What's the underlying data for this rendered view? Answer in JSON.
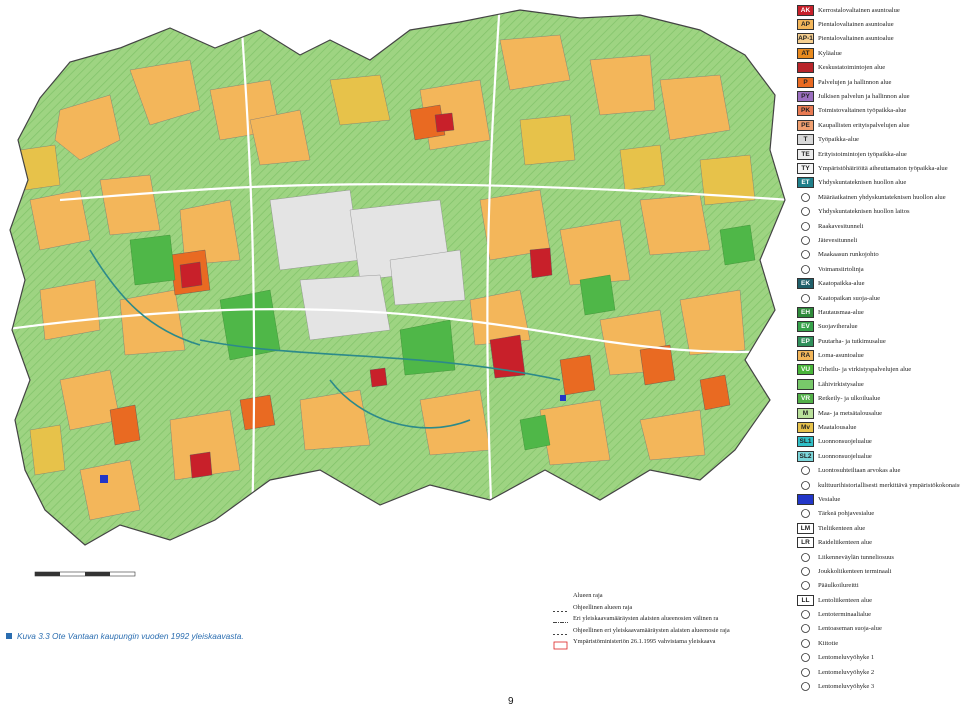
{
  "caption": "Kuva 3.3 Ote Vantaan kaupungin vuoden 1992 yleiskaavasta.",
  "page_number": "9",
  "legend": [
    {
      "code": "AK",
      "label": "Kerrostalovaltainen asuntoalue",
      "color": "#c8202a"
    },
    {
      "code": "AP",
      "label": "Pientalovaltainen asuntoalue",
      "color": "#f3b65a"
    },
    {
      "code": "AP-1",
      "label": "Pientalovaltainen asuntoalue",
      "color": "#f6cf8f"
    },
    {
      "code": "AT",
      "label": "Kyläalue",
      "color": "#e98a1e"
    },
    {
      "code": "",
      "label": "Keskustatoimintojen alue",
      "color": "#b8242a"
    },
    {
      "code": "P",
      "label": "Palvelujen ja hallinnon alue",
      "color": "#e96a22"
    },
    {
      "code": "PY",
      "label": "Julkisen palvelun ja hallinnon alue",
      "color": "#9b6fc0"
    },
    {
      "code": "PK",
      "label": "Toimistovaltainen työpaikka-alue",
      "color": "#e87a52"
    },
    {
      "code": "PE",
      "label": "Kaupallisten erityispalvelujen alue",
      "color": "#f0a070"
    },
    {
      "code": "T",
      "label": "Työpaikka-alue",
      "color": "#d8d8d8"
    },
    {
      "code": "TE",
      "label": "Erityistoimintojen työpaikka-alue",
      "color": "#ececec"
    },
    {
      "code": "TY",
      "label": "Ympäristöhäiriöitä aiheuttamaton työpaikka-alue",
      "color": "#f4f4f4"
    },
    {
      "code": "ET",
      "label": "Yhdyskuntateknisen huollon alue",
      "color": "#1f7f8a"
    },
    {
      "code": "",
      "label": "Määräaikainen yhdyskuntateknisen huollon alue",
      "color": "#ffffff",
      "symbol": "circle-arrow"
    },
    {
      "code": "",
      "label": "Yhdyskuntateknisen huollon laitos",
      "color": "#ffffff",
      "symbol": "circle-dash"
    },
    {
      "code": "",
      "label": "Raakavesitunneli",
      "color": "#ffffff",
      "symbol": "dash-circle"
    },
    {
      "code": "",
      "label": "Jätevesitunneli",
      "color": "#ffffff",
      "symbol": "dash-circle"
    },
    {
      "code": "",
      "label": "Maakaasun runkojohto",
      "color": "#ffffff",
      "symbol": "dash-circle"
    },
    {
      "code": "",
      "label": "Voimansiirtolinja",
      "color": "#ffffff",
      "symbol": "lightning"
    },
    {
      "code": "EK",
      "label": "Kaatopaikka-alue",
      "color": "#1f5f6a"
    },
    {
      "code": "",
      "label": "Kaatopaikan suoja-alue",
      "color": "#ffffff",
      "symbol": "circle-arrow"
    },
    {
      "code": "EH",
      "label": "Hautausmaa-alue",
      "color": "#2e8a3a"
    },
    {
      "code": "EV",
      "label": "Suojaviheralue",
      "color": "#36a24a"
    },
    {
      "code": "EP",
      "label": "Puutarha- ja tutkimusalue",
      "color": "#2f8f5a"
    },
    {
      "code": "RA",
      "label": "Loma-asuntoalue",
      "color": "#f3b65a"
    },
    {
      "code": "VU",
      "label": "Urheilu- ja virkistyspalvelujen alue",
      "color": "#49b53a"
    },
    {
      "code": "",
      "label": "Lähivirkistysalue",
      "color": "#78c86a"
    },
    {
      "code": "VR",
      "label": "Retkeily- ja ulkoilualue",
      "color": "#52b048"
    },
    {
      "code": "M",
      "label": "Maa- ja metsätalousalue",
      "color": "#b9e09a"
    },
    {
      "code": "Mv",
      "label": "Maatalousalue",
      "color": "#e7c24a"
    },
    {
      "code": "SL1",
      "label": "Luonnonsuojelualue",
      "color": "#2fc0c8"
    },
    {
      "code": "SL2",
      "label": "Luonnonsuojelualue",
      "color": "#7cd6da"
    },
    {
      "code": "",
      "label": "Luontosuhteiltaan arvokas alue",
      "color": "#ffffff",
      "symbol": "hatch-green"
    },
    {
      "code": "",
      "label": "kulttuurihistoriallisesti merkittävä ympäristökokonaisuus",
      "color": "#ffffff",
      "symbol": "hatch-grey"
    },
    {
      "code": "",
      "label": "Vesialue",
      "color": "#2236c8"
    },
    {
      "code": "",
      "label": "Tärkeä pohjavesialue",
      "color": "#ffffff",
      "symbol": "dots"
    },
    {
      "code": "LM",
      "label": "Tieliikenteen alue",
      "color": "#ffffff"
    },
    {
      "code": "LR",
      "label": "Raideliikenteen alue",
      "color": "#ffffff"
    },
    {
      "code": "",
      "label": "Liikenneväylän tunneliosuus",
      "color": "#ffffff",
      "symbol": "tunnel"
    },
    {
      "code": "",
      "label": "Joukkoliikenteen terminaali",
      "color": "#ffffff",
      "symbol": "terminal"
    },
    {
      "code": "",
      "label": "Pääulkoilureitti",
      "color": "#ffffff",
      "symbol": "dotted-line"
    },
    {
      "code": "LL",
      "label": "Lentoliikenteen alue",
      "color": "#ffffff"
    },
    {
      "code": "",
      "label": "Lentoterminaalialue",
      "color": "#ffffff",
      "symbol": "plane"
    },
    {
      "code": "",
      "label": "Lentoaseman suoja-alue",
      "color": "#ffffff",
      "symbol": "plane-zone"
    },
    {
      "code": "",
      "label": "Kiitotie",
      "color": "#ffffff",
      "symbol": "runway"
    },
    {
      "code": "",
      "label": "Lentomeluvyöhyke 1",
      "color": "#ffffff",
      "symbol": "noise"
    },
    {
      "code": "",
      "label": "Lentomeluvyöhyke 2",
      "color": "#ffffff",
      "symbol": "noise"
    },
    {
      "code": "",
      "label": "Lentomeluvyöhyke 3",
      "color": "#ffffff",
      "symbol": "noise"
    }
  ],
  "boundary_legend": [
    {
      "label": "Alueen raja",
      "style": "none"
    },
    {
      "label": "Ohjeellinen alueen raja",
      "style": "dashed"
    },
    {
      "label": "Eri yleiskaavamääräysten alaisten alueenosien välinen ra",
      "style": "dashdot"
    },
    {
      "label": "Ohjeellinen eri yleiskaavamääräysten alaisten alueenosie raja",
      "style": "dashed"
    },
    {
      "label": "Ympäristöministeriön 26.1.1995 vahvistama yleiskaava",
      "style": "red"
    }
  ],
  "map": {
    "colors": {
      "forest": "#8fcf73",
      "green": "#4fb748",
      "residential": "#f3b65a",
      "apartment": "#c8202a",
      "service": "#e96a22",
      "industry": "#d8d8d8",
      "agri": "#e7c24a",
      "water": "#2236c8",
      "route": "#2c8a8a",
      "boundary": "#444"
    }
  }
}
